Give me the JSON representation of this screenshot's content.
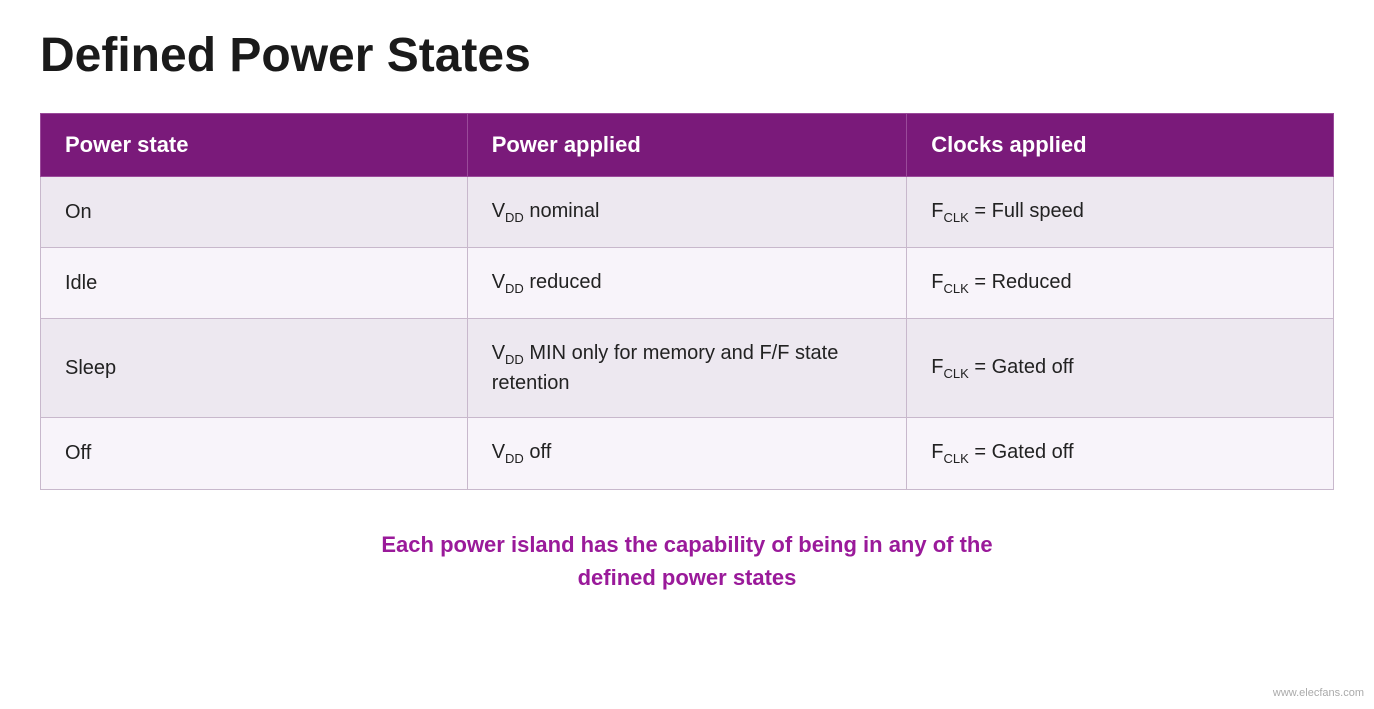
{
  "title": "Defined Power States",
  "table": {
    "headers": {
      "col1": "Power state",
      "col2": "Power applied",
      "col3": "Clocks applied"
    },
    "rows": [
      {
        "state": "On",
        "power_html": "V<sub>DD</sub> nominal",
        "clocks_html": "F<sub>CLK</sub> = Full speed"
      },
      {
        "state": "Idle",
        "power_html": "V<sub>DD</sub> reduced",
        "clocks_html": "F<sub>CLK</sub> = Reduced"
      },
      {
        "state": "Sleep",
        "power_html": "V<sub>DD</sub> MIN only for memory and F/F state retention",
        "clocks_html": "F<sub>CLK</sub> = Gated off"
      },
      {
        "state": "Off",
        "power_html": "V<sub>DD</sub> off",
        "clocks_html": "F<sub>CLK</sub> = Gated off"
      }
    ]
  },
  "footer": {
    "line1": "Each power island has the capability of being in any of the",
    "line2": "defined power states"
  },
  "watermark": "www.elecfans.com"
}
